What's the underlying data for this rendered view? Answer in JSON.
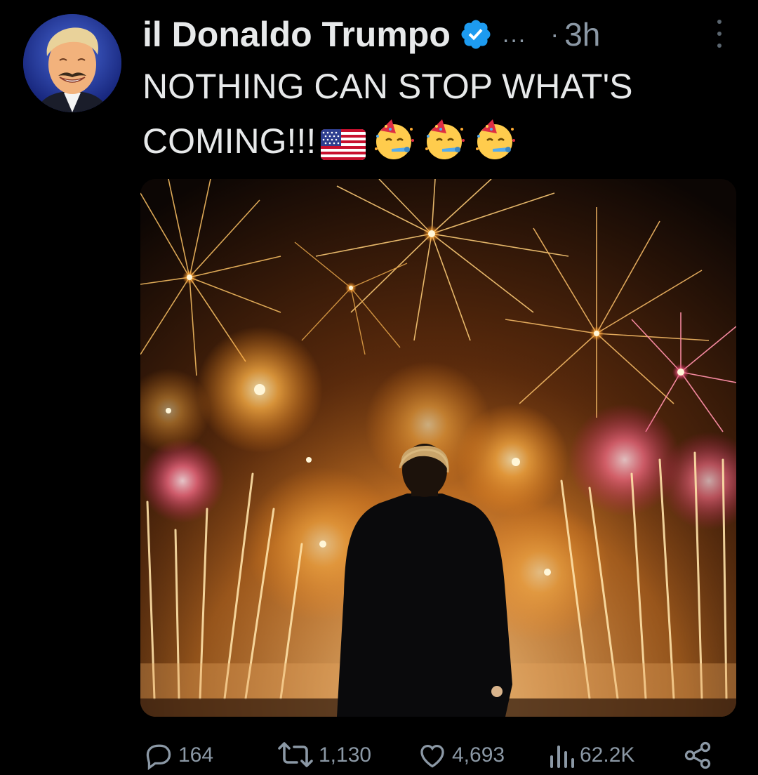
{
  "author": {
    "display_name": "il Donaldo Trumpo",
    "verified": true,
    "handle_truncated": "...",
    "separator": "·",
    "timestamp": "3h"
  },
  "tweet": {
    "text_line_1": "NOTHING CAN STOP WHAT'S",
    "text_line_2": "COMING!!!",
    "emojis": [
      "us-flag-emoji",
      "partying-face-emoji",
      "partying-face-emoji",
      "partying-face-emoji"
    ]
  },
  "media": {
    "type": "photo"
  },
  "actions": {
    "replies": "164",
    "retweets": "1,130",
    "likes": "4,693",
    "views": "62.2K"
  },
  "colors": {
    "background": "#000000",
    "text_primary": "#e7e9ea",
    "text_secondary": "#8b98a5",
    "verified_blue": "#1d9bf0"
  },
  "icons": [
    "verified-badge-icon",
    "more-icon",
    "reply-icon",
    "retweet-icon",
    "like-icon",
    "views-icon",
    "share-icon"
  ]
}
